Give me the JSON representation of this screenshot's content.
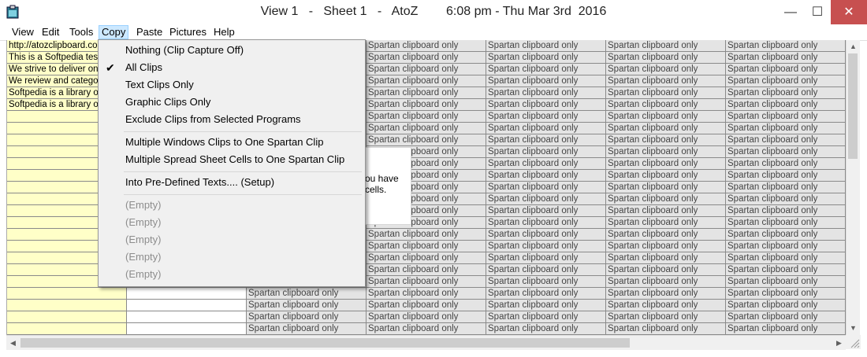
{
  "window": {
    "title": "View 1   -   Sheet 1   -   AtoZ        6:08 pm - Thu Mar 3rd  2016",
    "minimize_glyph": "—",
    "maximize_glyph": "☐",
    "close_glyph": "✕"
  },
  "menubar": [
    "View",
    "Edit",
    "Tools",
    "Copy",
    "Paste",
    "Pictures",
    "Help"
  ],
  "copy_menu": {
    "group1": [
      "Nothing (Clip Capture Off)",
      "All Clips",
      "Text Clips Only",
      "Graphic Clips Only",
      "Exclude Clips from Selected Programs"
    ],
    "group2": [
      "Multiple Windows Clips to One Spartan Clip",
      "Multiple Spread Sheet Cells to One Spartan Clip"
    ],
    "group3": [
      "Into Pre-Defined Texts.... (Setup)"
    ],
    "empty": [
      "(Empty)",
      "(Empty)",
      "(Empty)",
      "(Empty)",
      "(Empty)"
    ],
    "checked_item": "All Clips",
    "check_glyph": "✔"
  },
  "sheet": {
    "col0_texts": [
      "http://atozclipboard.com",
      "This is a Softpedia test",
      "We strive to deliver only",
      "We review and categoriz",
      "Softpedia is a library of o",
      "Softpedia is a library of o"
    ],
    "cell_text": "Spartan clipboard only",
    "dialog_lines": [
      "ou have",
      "cells."
    ]
  },
  "colors": {
    "yellow_cell": "#ffffc8",
    "gray_cell": "#e4e4e4",
    "menu_highlight": "#cce8ff",
    "close_button": "#c75050"
  }
}
